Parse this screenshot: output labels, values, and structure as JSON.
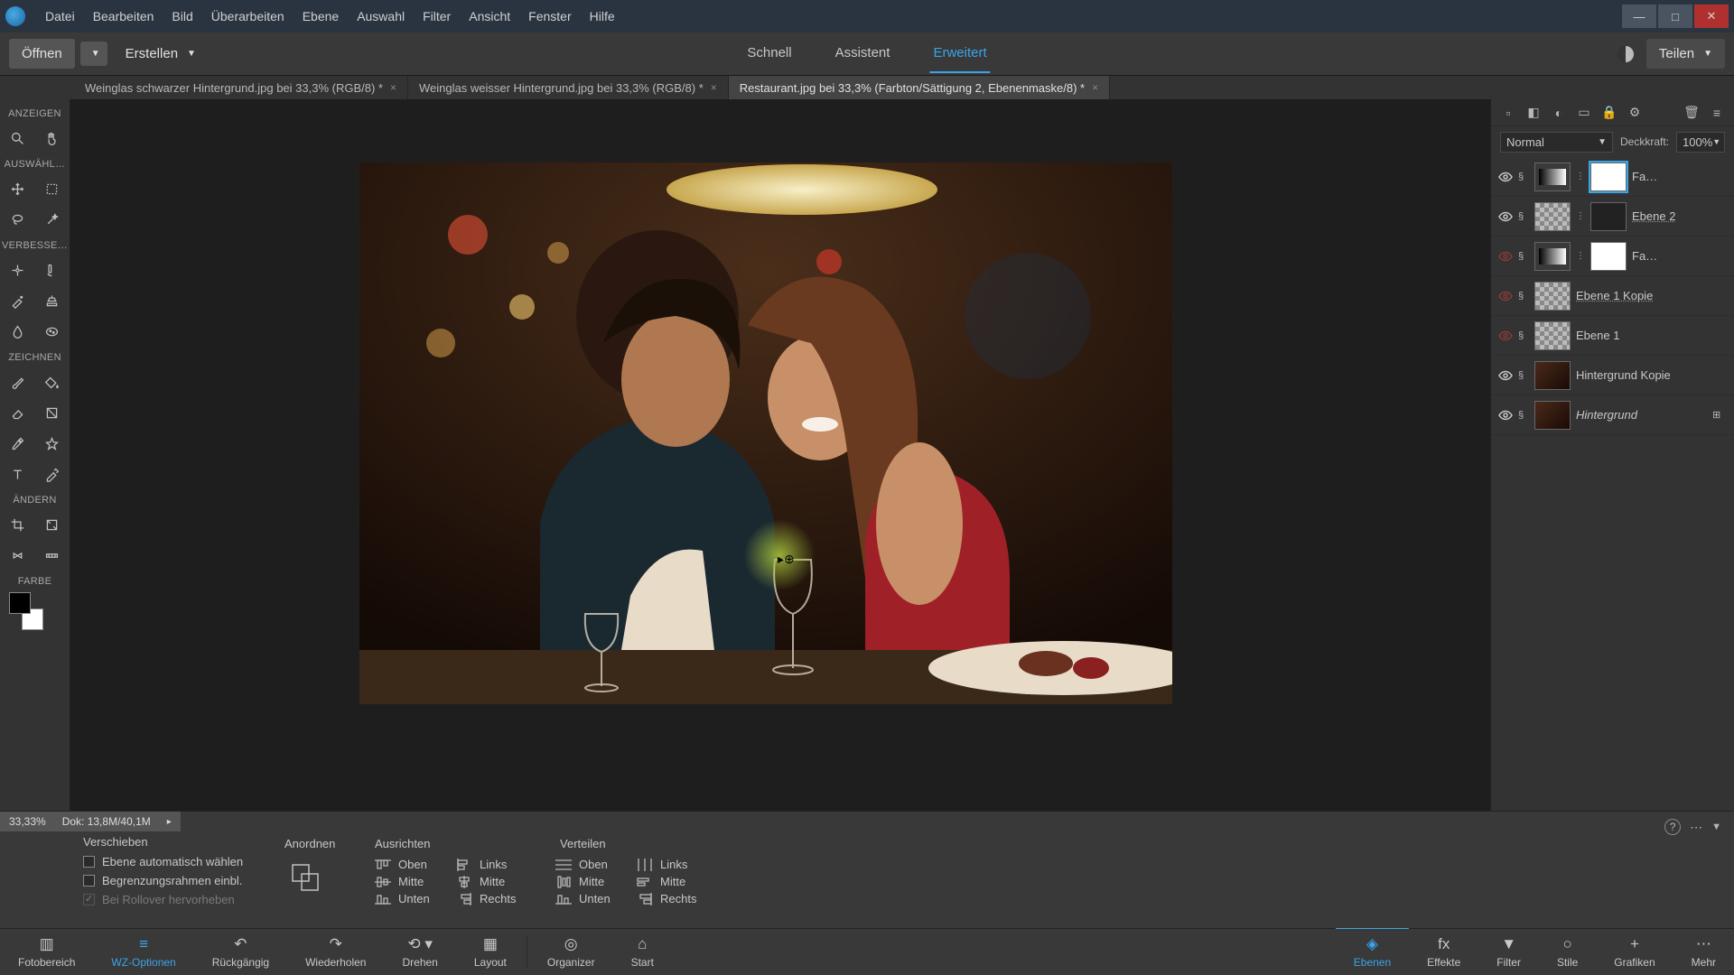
{
  "menu": [
    "Datei",
    "Bearbeiten",
    "Bild",
    "Überarbeiten",
    "Ebene",
    "Auswahl",
    "Filter",
    "Ansicht",
    "Fenster",
    "Hilfe"
  ],
  "secondbar": {
    "open": "Öffnen",
    "create": "Erstellen",
    "modes": [
      "Schnell",
      "Assistent",
      "Erweitert"
    ],
    "active_mode": 2,
    "share": "Teilen"
  },
  "doctabs": [
    {
      "label": "Weinglas schwarzer Hintergrund.jpg bei 33,3% (RGB/8) *",
      "active": false
    },
    {
      "label": "Weinglas weisser Hintergrund.jpg bei 33,3% (RGB/8) *",
      "active": false
    },
    {
      "label": "Restaurant.jpg bei 33,3% (Farbton/Sättigung 2, Ebenenmaske/8) *",
      "active": true
    }
  ],
  "tool_sections": {
    "view": "ANZEIGEN",
    "select": "AUSWÄHL…",
    "enhance": "VERBESSE…",
    "draw": "ZEICHNEN",
    "modify": "ÄNDERN",
    "color": "FARBE"
  },
  "blend": {
    "mode": "Normal",
    "opacity_label": "Deckkraft:",
    "opacity": "100%"
  },
  "layers": [
    {
      "vis": true,
      "type": "adjust",
      "thumbs": [
        "grad",
        "white-sel"
      ],
      "name": "Fa…",
      "underline": false
    },
    {
      "vis": true,
      "type": "adjust",
      "thumbs": [
        "checker",
        "dark"
      ],
      "name": "Ebene 2",
      "underline": true
    },
    {
      "vis": false,
      "type": "adjust",
      "thumbs": [
        "grad",
        "white"
      ],
      "name": "Fa…",
      "underline": false
    },
    {
      "vis": false,
      "type": "layer",
      "thumbs": [
        "checker"
      ],
      "name": "Ebene 1 Kopie",
      "underline": true
    },
    {
      "vis": false,
      "type": "layer",
      "thumbs": [
        "checker"
      ],
      "name": "Ebene 1",
      "underline": false
    },
    {
      "vis": true,
      "type": "layer",
      "thumbs": [
        "photo"
      ],
      "name": "Hintergrund Kopie",
      "underline": false
    },
    {
      "vis": true,
      "type": "bg",
      "thumbs": [
        "photo"
      ],
      "name": "Hintergrund",
      "underline": false,
      "italic": true,
      "locked": true
    }
  ],
  "status": {
    "zoom": "33,33%",
    "doc": "Dok: 13,8M/40,1M"
  },
  "opts": {
    "title": "Verschieben",
    "check1": "Ebene automatisch wählen",
    "check2": "Begrenzungsrahmen einbl.",
    "check3": "Bei Rollover hervorheben",
    "arrange": "Anordnen",
    "align": "Ausrichten",
    "distribute": "Verteilen",
    "top": "Oben",
    "middle": "Mitte",
    "bottom": "Unten",
    "left": "Links",
    "center": "Mitte",
    "right": "Rechts"
  },
  "bottombar": {
    "left": [
      {
        "icon": "▥",
        "label": "Fotobereich"
      },
      {
        "icon": "≡",
        "label": "WZ-Optionen",
        "active": true
      },
      {
        "icon": "↶",
        "label": "Rückgängig"
      },
      {
        "icon": "↷",
        "label": "Wiederholen"
      },
      {
        "icon": "⟲",
        "label": "Drehen",
        "caret": true
      },
      {
        "icon": "▦",
        "label": "Layout"
      }
    ],
    "center": [
      {
        "icon": "◎",
        "label": "Organizer"
      },
      {
        "icon": "⌂",
        "label": "Start"
      }
    ],
    "right": [
      {
        "icon": "◈",
        "label": "Ebenen",
        "active": true
      },
      {
        "icon": "fx",
        "label": "Effekte"
      },
      {
        "icon": "▼",
        "label": "Filter"
      },
      {
        "icon": "○",
        "label": "Stile"
      },
      {
        "icon": "+",
        "label": "Grafiken"
      },
      {
        "icon": "⋯",
        "label": "Mehr"
      }
    ]
  }
}
